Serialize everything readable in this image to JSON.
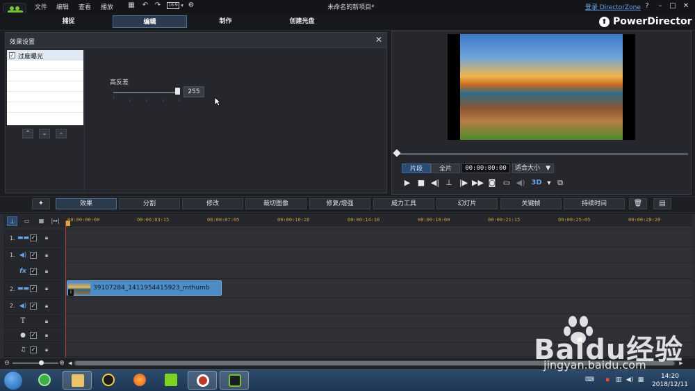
{
  "titlebar": {
    "menus": [
      "文件",
      "编辑",
      "查看",
      "播放"
    ],
    "aspect_ratio": "16:9",
    "window_title": "未命名的新项目*",
    "login": "登录 DirectorZone",
    "help": "?"
  },
  "modes": {
    "tabs": [
      "捕捉",
      "编辑",
      "制作",
      "创建光盘"
    ],
    "active": "编辑",
    "brand": "PowerDirector"
  },
  "effect_panel": {
    "title": "效果设置",
    "effects": [
      "过度曝光"
    ],
    "effect_checked": true,
    "param_label": "高反差",
    "param_value": "255",
    "param_fraction": 1.0
  },
  "preview": {
    "clip_label": "片段",
    "full_label": "全片",
    "timecode": "00:00:00:00",
    "fit_label": "适合大小",
    "three_d": "3D"
  },
  "room_bar": {
    "buttons": [
      "效果",
      "分割",
      "修改",
      "裁切图像",
      "修复/增强",
      "威力工具",
      "幻灯片",
      "关键帧",
      "持续时间"
    ],
    "active": "效果"
  },
  "timeline": {
    "ruler_ticks": [
      "00:00:00:00",
      "00:00:03:15",
      "00:00:07:05",
      "00:00:10:20",
      "00:00:14:10",
      "00:00:18:00",
      "00:00:21:15",
      "00:00:25:05",
      "00:00:28:20"
    ],
    "tracks": [
      {
        "num": "1.",
        "icon": "video-track-icon",
        "checked": true
      },
      {
        "num": "1.",
        "icon": "audio-track-icon",
        "checked": true
      },
      {
        "num": "",
        "icon": "fx-track-icon",
        "checked": true
      },
      {
        "num": "2.",
        "icon": "video-track-icon",
        "checked": true
      },
      {
        "num": "2.",
        "icon": "audio-track-icon",
        "checked": true
      },
      {
        "num": "",
        "icon": "title-track-icon",
        "checked": false
      },
      {
        "num": "",
        "icon": "voice-track-icon",
        "checked": true
      },
      {
        "num": "",
        "icon": "music-track-icon",
        "checked": true
      }
    ],
    "clip_name": "39107284_1411954415923_mthumb"
  },
  "taskbar": {
    "time": "14:20",
    "date": "2018/12/11"
  },
  "watermark": {
    "text": "Baidu经验",
    "url": "jingyan.baidu.com"
  },
  "colors": {
    "accent": "#2b3a4d",
    "accent_border": "#4f6e93",
    "clip": "#4c8cc7",
    "playhead": "#b33a3a",
    "tick_label": "#c49a3a"
  }
}
